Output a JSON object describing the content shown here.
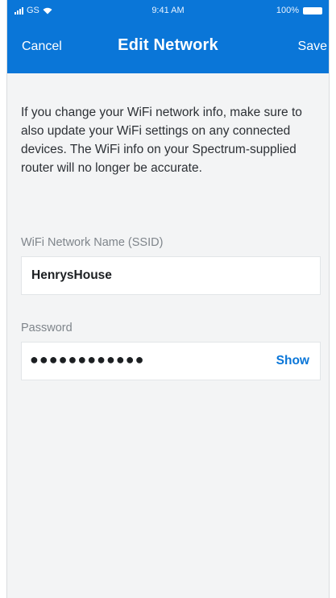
{
  "status_bar": {
    "carrier": "GS",
    "time": "9:41 AM",
    "battery": "100%"
  },
  "nav": {
    "cancel_label": "Cancel",
    "title": "Edit Network",
    "save_label": "Save"
  },
  "intro_text": "If you change your WiFi network info, make sure to also update your WiFi settings on any connected devices. The WiFi info on your Spectrum-supplied router will no longer be accurate.",
  "ssid_field": {
    "label": "WiFi Network Name (SSID)",
    "value": "HenrysHouse"
  },
  "password_field": {
    "label": "Password",
    "value": "●●●●●●●●●●●●",
    "show_label": "Show"
  },
  "colors": {
    "brand": "#0a76d8",
    "background": "#f3f4f5"
  }
}
